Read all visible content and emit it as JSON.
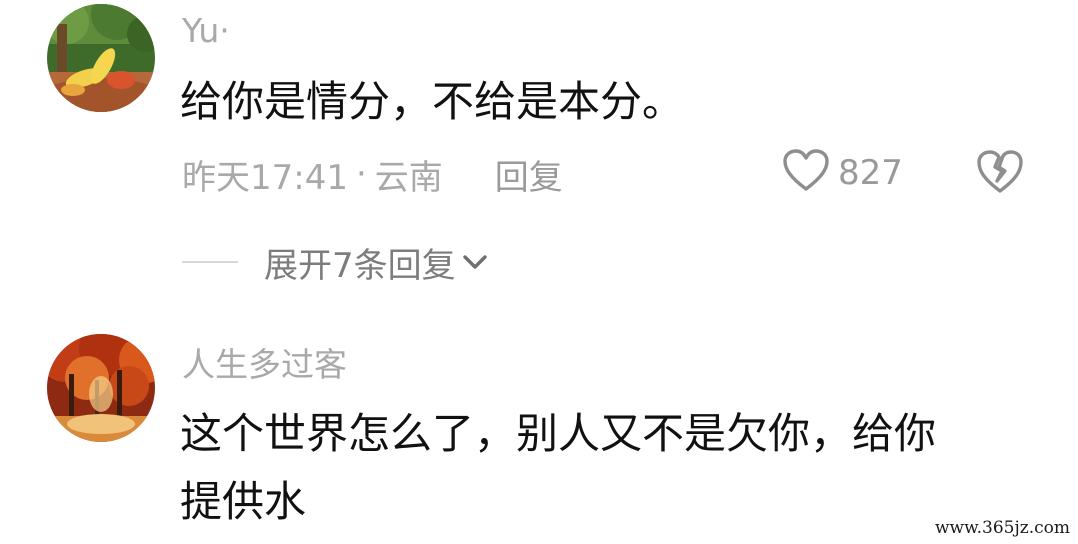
{
  "comments": [
    {
      "username": "Yu·",
      "text_lines": [
        "给你是情分，不给是本分。"
      ],
      "time": "昨天17:41",
      "separator": "·",
      "location": "云南",
      "reply_label": "回复",
      "like_count": "827",
      "expand_label": "展开7条回复",
      "avatar_icon": "fruit-photo-avatar",
      "like_icon": "heart-outline-icon",
      "dislike_icon": "broken-heart-icon"
    },
    {
      "username": "人生多过客",
      "text_lines": [
        "这个世界怎么了，别人又不是欠你，给你",
        "提供水"
      ],
      "avatar_icon": "autumn-forest-avatar"
    }
  ],
  "watermark": "www.365jz.com",
  "colors": {
    "username": "#a9a9a9",
    "text": "#111111",
    "meta": "#a9a9a9",
    "expand": "#7d7d7d",
    "background": "#ffffff"
  }
}
